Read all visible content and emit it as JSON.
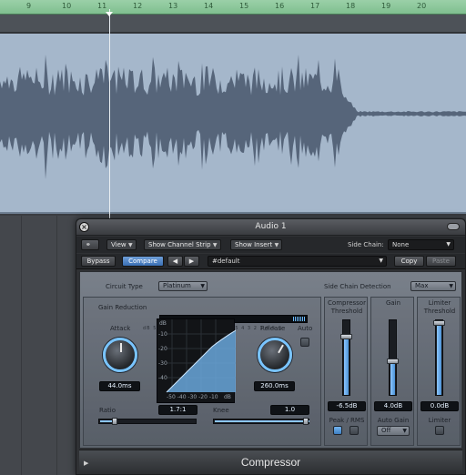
{
  "arrange": {
    "ruler_marks": [
      "9",
      "10",
      "11",
      "12",
      "13",
      "14",
      "15",
      "16",
      "17",
      "18",
      "19",
      "20"
    ]
  },
  "plugin": {
    "window_title": "Audio 1",
    "toolbar": {
      "link_icon": "link-icon",
      "view_label": "View",
      "show_channel_strip_label": "Show Channel Strip",
      "show_insert_label": "Show Insert",
      "side_chain_label": "Side Chain:",
      "side_chain_value": "None",
      "bypass_label": "Bypass",
      "compare_label": "Compare",
      "prev_arrow": "◀",
      "next_arrow": "▶",
      "preset_name": "#default",
      "copy_label": "Copy",
      "paste_label": "Paste"
    },
    "body": {
      "circuit_type_label": "Circuit Type",
      "circuit_type_value": "Platinum",
      "side_chain_detection_label": "Side Chain Detection",
      "side_chain_detection_value": "Max",
      "gain_reduction_label": "Gain Reduction",
      "gain_reduction_scale": "dB 50 40 30 20 15 12 10 8 6 5 4 3 2 1 0.5 0",
      "attack_label": "Attack",
      "attack_value": "44.0ms",
      "release_label": "Release",
      "release_value": "260.0ms",
      "auto_label": "Auto",
      "graph_db_label": "dB",
      "graph_y_ticks": [
        "-10",
        "-20",
        "-30",
        "-40"
      ],
      "graph_x_ticks": "-50 -40 -30 -20 -10",
      "graph_x_unit": "dB",
      "ratio_label": "Ratio",
      "ratio_value": "1.7:1",
      "knee_label": "Knee",
      "knee_value": "1.0",
      "compressor_threshold_label_1": "Compressor",
      "compressor_threshold_label_2": "Threshold",
      "compressor_threshold_value": "-6.5dB",
      "gain_label": "Gain",
      "gain_value": "4.0dB",
      "limiter_threshold_label_1": "Limiter",
      "limiter_threshold_label_2": "Threshold",
      "limiter_threshold_value": "0.0dB",
      "peak_rms_label": "Peak / RMS",
      "auto_gain_label": "Auto Gain",
      "auto_gain_value": "Off",
      "limiter_label": "Limiter",
      "compressor_threshold_level": 0.78,
      "gain_level": 0.45,
      "limiter_threshold_level": 1.0
    },
    "footer": {
      "plugin_name": "Compressor",
      "disclosure": "▶"
    }
  }
}
